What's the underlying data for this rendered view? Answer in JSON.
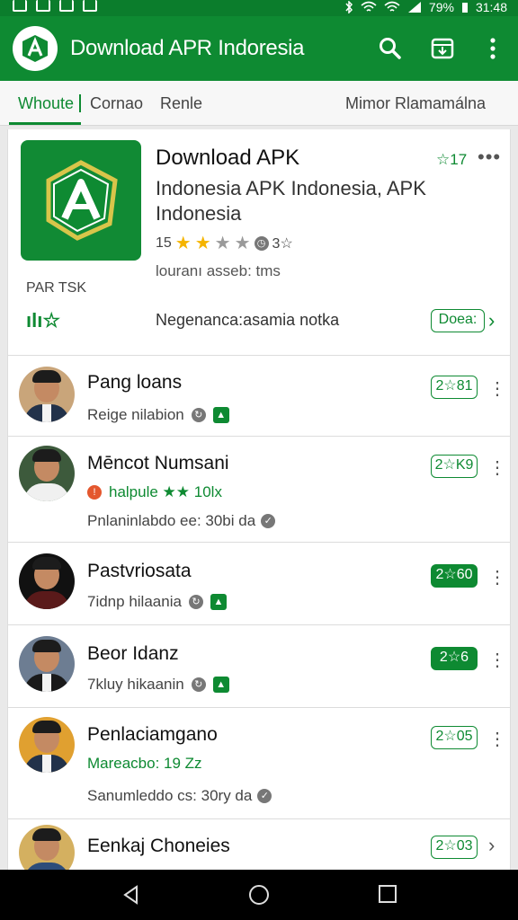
{
  "status_bar": {
    "battery_text": "79%",
    "time": "31:48"
  },
  "app_bar": {
    "title": "Download APR Indoresia"
  },
  "tabs": [
    {
      "label": "Whoute",
      "active": true
    },
    {
      "label": "Cornao",
      "active": false
    },
    {
      "label": "Renle",
      "active": false
    },
    {
      "label": "Mimor Rlamamálna",
      "active": false
    }
  ],
  "featured": {
    "title": "Download APK",
    "subtitle": "Indonesia APK Indonesia, APK Indonesia",
    "rating_text": "15",
    "rating_suffix": "3☆",
    "meta": "louranı asseb: tms",
    "tag": "PAR TSK",
    "fav": "☆17",
    "description": "Negenanca:asamia notka",
    "button_label": "Doea:"
  },
  "list": [
    {
      "name": "Pang loans",
      "sub": "Reige nilabion",
      "pill": "2☆81",
      "pill_filled": false
    },
    {
      "name": "Mēncot Numsani",
      "sub": "halpule ★★ 10lx",
      "extra": "Pnlaninlabdo ee:  30bi da",
      "pill": "2☆K9",
      "pill_filled": false
    },
    {
      "name": "Pastvriosata",
      "sub": "7idnp hilaania",
      "pill": "2☆60",
      "pill_filled": true
    },
    {
      "name": "Beor Idanz",
      "sub": "7kluy hikaanin",
      "pill": "2☆6",
      "pill_filled": true
    },
    {
      "name": "Penlaciamgano",
      "sub": "Mareacbo: 19 Zz",
      "extra": "Sanumleddo cs:  30ry da",
      "pill": "2☆05",
      "pill_filled": false
    },
    {
      "name": "Eenkaj Choneies",
      "sub": "",
      "pill": "2☆03",
      "pill_filled": false
    }
  ],
  "colors": {
    "primary": "#0e8a32",
    "status": "#0b7d2c",
    "star": "#f5b400"
  }
}
